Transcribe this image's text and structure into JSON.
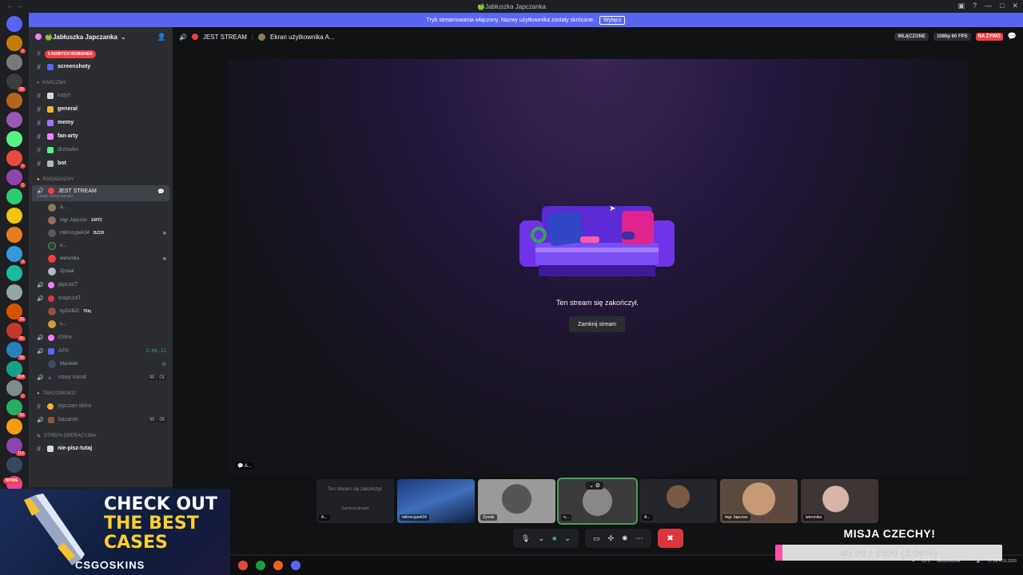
{
  "window": {
    "title": "🍏Jabłuszka Japczanka"
  },
  "banner": {
    "text": "Tryb streamowania włączony. Nazwy użytkownika zostały skrócone.",
    "button": "Wyłącz"
  },
  "guild_badges": [
    "",
    "1",
    "",
    "35",
    "",
    "",
    "",
    "1",
    "1",
    "",
    "",
    "",
    "2",
    "",
    "",
    "26",
    "81",
    "36",
    "204",
    "1",
    "50",
    "",
    "116",
    "",
    "682",
    "25",
    "1"
  ],
  "new_badge": "NOWE",
  "sidebar": {
    "server_name": "🍏Jabłuszka Japczanka",
    "mentions_pill": "5 NOWYCH WZMIANEK",
    "channels_top": [
      {
        "name": "kom",
        "unread": false
      },
      {
        "name": "screenshoty",
        "unread": true
      }
    ],
    "category_karczma": "KARCZMA",
    "karczma_channels": [
      {
        "name": "katyń",
        "unread": false
      },
      {
        "name": "general",
        "unread": true
      },
      {
        "name": "memy",
        "unread": true
      },
      {
        "name": "fan-arty",
        "unread": true
      },
      {
        "name": "drzewko",
        "unread": false
      },
      {
        "name": "bot",
        "unread": true
      }
    ],
    "category_pogaduchy": "POGADUCHY",
    "voice_active": {
      "name": "JEST STREAM",
      "status": "Ustaw status kanału"
    },
    "voice_users": [
      {
        "name": "A...",
        "tag": ""
      },
      {
        "name": "mgr Japczan",
        "tag": "EMT2"
      },
      {
        "name": "mikrocypek34",
        "tag": "BZZR"
      },
      {
        "name": "n...",
        "tag": ""
      },
      {
        "name": "weronika",
        "tag": ""
      },
      {
        "name": "Zyniak",
        "tag": ""
      }
    ],
    "voice_japczat": "japczaT",
    "voice_srapczat": "srapczaT",
    "srapczat_users": [
      {
        "name": "byDABZI",
        "tag": "76lq"
      },
      {
        "name": "s...",
        "tag": ""
      }
    ],
    "voice_chlew": "chlew",
    "voice_afk": "AFK",
    "afk_timer": "2:06:21",
    "afk_user": "Maniekk",
    "voice_new": "nowy kanał",
    "voice_new_counts": [
      "00",
      "01"
    ],
    "category_targowisko": "TARGOWISKO",
    "targ_channels": [
      "japczan-skins",
      "bazarek"
    ],
    "bazarek_counts": [
      "00",
      "05"
    ],
    "category_strefa": "STREFA OPERACYJNA",
    "strefa_channel": "nie-pisz-tutaj"
  },
  "main": {
    "channel": "JEST STREAM",
    "stream_of": "Ekran użytkownika A...",
    "enabled": "WŁĄCZONE",
    "quality": "1080p 60 FPS",
    "live": "NA ŻYWO",
    "ended_text": "Ten stream się zakończył.",
    "close_button": "Zamknij stream",
    "stage_label": "A..."
  },
  "tiles": [
    {
      "name": "A...",
      "mini_text": "Ten stream się zakończył.",
      "mini_btn": "Zamknij stream",
      "color": "#1f2026"
    },
    {
      "name": "mikrocypek34",
      "color": "#2a4f86"
    },
    {
      "name": "Zyniak",
      "color": "#8a8a8a"
    },
    {
      "name": "n...",
      "color": "#4a4a4a"
    },
    {
      "name": "A...",
      "color": "#2a2a2e"
    },
    {
      "name": "mgr Japczan",
      "color": "#6b5a4e"
    },
    {
      "name": "weronika",
      "color": "#5a4c48"
    }
  ],
  "promo": {
    "line1": "CHECK OUT",
    "line2": "THE BEST",
    "line3": "CASES",
    "brand": "CSG⭘SKINS"
  },
  "overlay": {
    "title": "MISJA CZECHY!",
    "progress_text": "45.00 / 1500 (3.00%)",
    "progress_fraction": 0.03
  },
  "tray": {
    "weather": "13°C",
    "weather_sub": "Bezchmurnie",
    "time": "17:58",
    "date": "4.03.2026"
  }
}
